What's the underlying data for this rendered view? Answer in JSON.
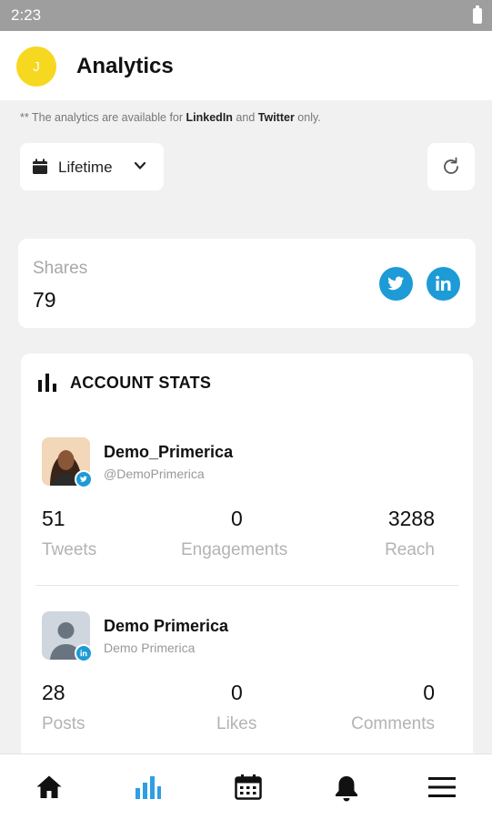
{
  "status_bar": {
    "time": "2:23"
  },
  "header": {
    "avatar_initial": "J",
    "title": "Analytics"
  },
  "notice": {
    "prefix": "** The analytics are available for",
    "network1": "LinkedIn",
    "and": "and",
    "network2": "Twitter",
    "suffix": "only."
  },
  "filter": {
    "period": "Lifetime"
  },
  "shares": {
    "label": "Shares",
    "value": "79"
  },
  "account_stats": {
    "title": "ACCOUNT STATS",
    "accounts": [
      {
        "name": "Demo_Primerica",
        "handle": "@DemoPrimerica",
        "network": "twitter",
        "stats": [
          {
            "value": "51",
            "label": "Tweets"
          },
          {
            "value": "0",
            "label": "Engagements"
          },
          {
            "value": "3288",
            "label": "Reach"
          }
        ]
      },
      {
        "name": "Demo Primerica",
        "handle": "Demo Primerica",
        "network": "linkedin",
        "stats": [
          {
            "value": "28",
            "label": "Posts"
          },
          {
            "value": "0",
            "label": "Likes"
          },
          {
            "value": "0",
            "label": "Comments"
          }
        ]
      }
    ]
  },
  "nav": {
    "items": [
      {
        "icon": "home-icon",
        "active": false
      },
      {
        "icon": "analytics-icon",
        "active": true
      },
      {
        "icon": "calendar-icon",
        "active": false
      },
      {
        "icon": "bell-icon",
        "active": false
      },
      {
        "icon": "menu-icon",
        "active": false
      }
    ]
  },
  "colors": {
    "accent": "#1d9bd6",
    "avatar": "#f6d820",
    "nav_active": "#2f9ee3",
    "nav_inactive": "#111111"
  }
}
